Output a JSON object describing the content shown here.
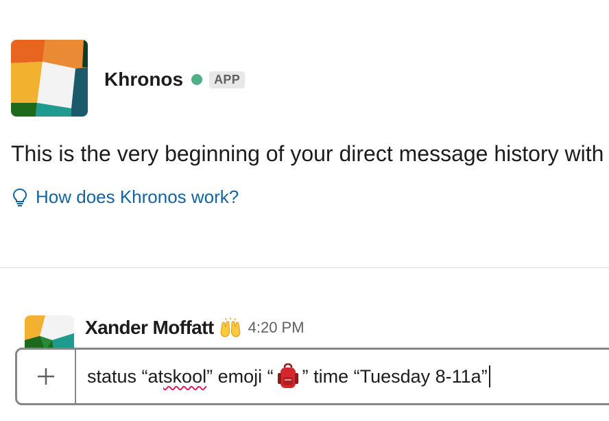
{
  "app": {
    "name": "Khronos",
    "badge": "APP",
    "presence_color": "#4faf86",
    "logo_icon": "khronos-logo"
  },
  "intro": {
    "text": "This is the very beginning of your direct message history with"
  },
  "help_link": {
    "icon": "lightbulb-icon",
    "label": "How does Khronos work?"
  },
  "message": {
    "sender": "Xander Moffatt",
    "status_emoji": "raised-hands",
    "timestamp": "4:20 PM"
  },
  "composer": {
    "attach_icon": "plus-icon",
    "text_part1": "status “at ",
    "misspelled_word": "skool",
    "text_part2": "” emoji “",
    "emoji": "backpack",
    "text_part3": "” time “Tuesday 8-11a”"
  },
  "colors": {
    "link": "#1264a3",
    "text": "#1d1c1d",
    "muted": "#616061",
    "border": "#868686",
    "spellcheck": "#e01e5a"
  }
}
